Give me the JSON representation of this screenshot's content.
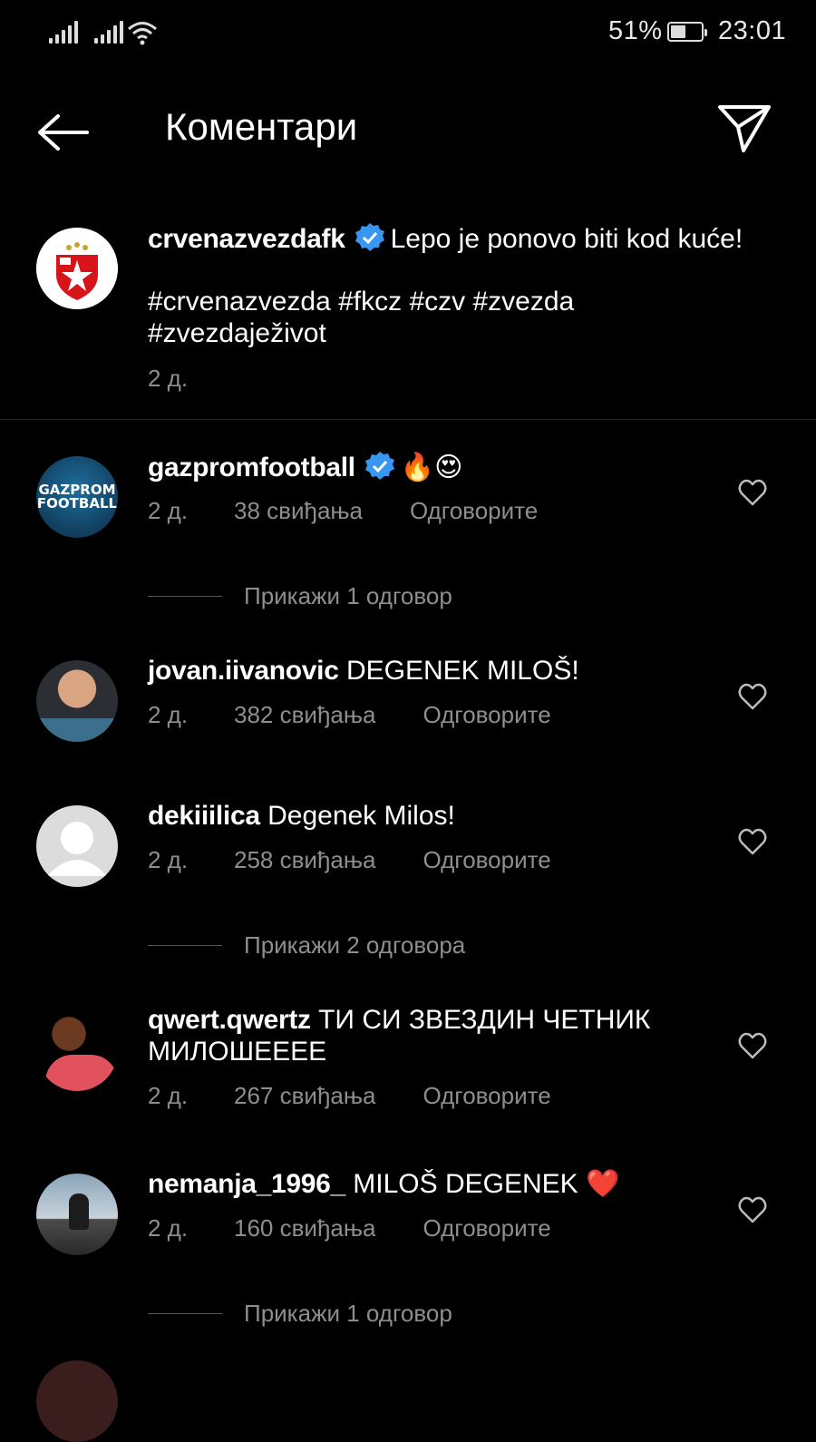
{
  "status_bar": {
    "battery_percent": "51%",
    "time": "23:01",
    "battery_level": 0.51,
    "icons": [
      "signal-icon",
      "signal-icon",
      "wifi-icon",
      "battery-icon"
    ]
  },
  "header": {
    "title": "Коментари",
    "back_icon": "arrow-left-icon",
    "send_icon": "paper-plane-icon"
  },
  "post": {
    "username": "crvenazvezdafk",
    "verified": true,
    "caption": "Lepo je ponovo biti kod kuće!",
    "hashtags_line1": "#crvenazvezda #fkcz #czv #zvezda",
    "hashtags_line2": "#zvezdaježivot",
    "time": "2 д."
  },
  "comments": [
    {
      "username": "gazpromfootball",
      "verified": true,
      "text": "🔥😍",
      "time": "2 д.",
      "likes": "38 свиђања",
      "reply": "Одговорите",
      "avatar_text_1": "GAZPROM",
      "avatar_text_2": "FOOTBALL"
    },
    {
      "username": "jovan.iivanovic",
      "text": "DEGENEK MILOŠ!",
      "time": "2 д.",
      "likes": "382 свиђања",
      "reply": "Одговорите"
    },
    {
      "username": "dekiiilica",
      "text": "Degenek Milos!",
      "time": "2 д.",
      "likes": "258 свиђања",
      "reply": "Одговорите"
    },
    {
      "username": "qwert.qwertz",
      "text": "ТИ СИ ЗВЕЗДИН ЧЕТНИК",
      "text2": "МИЛОШЕЕЕЕ",
      "time": "2 д.",
      "likes": "267 свиђања",
      "reply": "Одговорите"
    },
    {
      "username": "nemanja_1996_",
      "text": "MILOŠ DEGENEK ❤️",
      "time": "2 д.",
      "likes": "160 свиђања",
      "reply": "Одговорите"
    }
  ],
  "view_replies": [
    "Прикажи 1 одговор",
    "Прикажи 2 одговора",
    "Прикажи 1 одговор"
  ],
  "colors": {
    "background": "#000000",
    "muted": "#8e8e8e",
    "verified": "#3897f0",
    "brand_red": "#d7141a"
  }
}
